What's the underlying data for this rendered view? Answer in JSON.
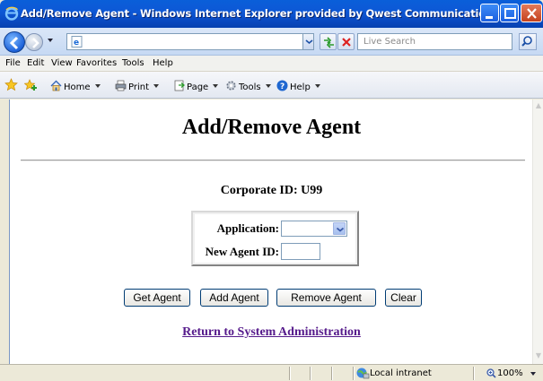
{
  "window": {
    "title": "Add/Remove Agent - Windows Internet Explorer provided by Qwest Communications"
  },
  "address_bar": {
    "url": "",
    "search_placeholder": "Live Search"
  },
  "menu": {
    "items": [
      "File",
      "Edit",
      "View",
      "Favorites",
      "Tools",
      "Help"
    ]
  },
  "command_bar": {
    "home": "Home",
    "print": "Print",
    "page": "Page",
    "tools": "Tools",
    "help": "Help"
  },
  "page": {
    "title": "Add/Remove Agent",
    "corporate_id_line": "Corporate ID: U99",
    "form": {
      "application_label": "Application:",
      "application_value": "",
      "agent_id_label": "New Agent ID:",
      "agent_id_value": ""
    },
    "buttons": {
      "get_agent": "Get Agent",
      "add_agent": "Add Agent",
      "remove_agent": "Remove Agent",
      "clear": "Clear"
    },
    "return_link": "Return to System Administration"
  },
  "status_bar": {
    "zone": "Local intranet",
    "zoom": "100%"
  },
  "colors": {
    "title_bar": "#0a5fd9",
    "visited_link": "#551a8b"
  }
}
